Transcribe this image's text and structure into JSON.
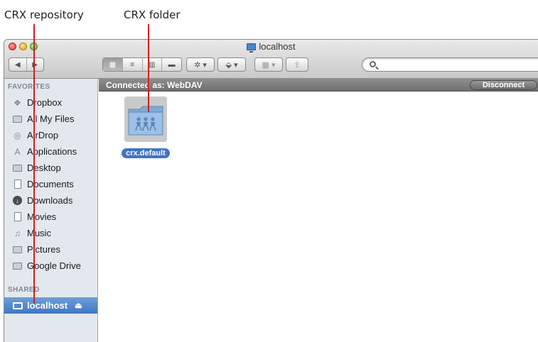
{
  "callouts": {
    "repository": "CRX repository",
    "folder": "CRX folder"
  },
  "window": {
    "title": "localhost",
    "title_icon": "network-server-icon"
  },
  "toolbar": {
    "back": "◀",
    "forward": "▶",
    "view_icons": [
      "icon-view-icon",
      "list-view-icon",
      "column-view-icon",
      "coverflow-view-icon"
    ],
    "action": "✲ ▾",
    "dropbox": "⬙ ▾",
    "arrange": "▦ ▾",
    "share": "⇪"
  },
  "search": {
    "placeholder": ""
  },
  "sidebar": {
    "favorites_heading": "FAVORITES",
    "items": [
      {
        "label": "Dropbox",
        "icon": "dropbox-icon"
      },
      {
        "label": "All My Files",
        "icon": "all-files-icon"
      },
      {
        "label": "AirDrop",
        "icon": "airdrop-icon"
      },
      {
        "label": "Applications",
        "icon": "applications-icon"
      },
      {
        "label": "Desktop",
        "icon": "desktop-icon"
      },
      {
        "label": "Documents",
        "icon": "documents-icon"
      },
      {
        "label": "Downloads",
        "icon": "downloads-icon"
      },
      {
        "label": "Movies",
        "icon": "movies-icon"
      },
      {
        "label": "Music",
        "icon": "music-icon"
      },
      {
        "label": "Pictures",
        "icon": "pictures-icon"
      },
      {
        "label": "Google Drive",
        "icon": "folder-icon"
      }
    ],
    "shared_heading": "SHARED",
    "shared_items": [
      {
        "label": "localhost",
        "icon": "monitor-icon",
        "eject": "⏏"
      }
    ]
  },
  "pathbar": {
    "connected_text": "Connected as: WebDAV",
    "disconnect_label": "Disconnect"
  },
  "content": {
    "items": [
      {
        "label": "crx.default",
        "icon": "shared-folder-icon"
      }
    ]
  },
  "colors": {
    "callout_line": "#d1201f",
    "selection": "#3e74c4",
    "sidebar_bg": "#e3e8ee"
  }
}
